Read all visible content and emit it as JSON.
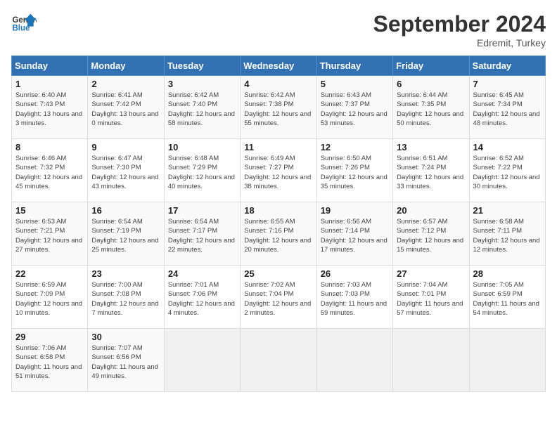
{
  "header": {
    "logo_line1": "General",
    "logo_line2": "Blue",
    "month": "September 2024",
    "location": "Edremit, Turkey"
  },
  "days_of_week": [
    "Sunday",
    "Monday",
    "Tuesday",
    "Wednesday",
    "Thursday",
    "Friday",
    "Saturday"
  ],
  "weeks": [
    [
      {
        "day": "1",
        "sunrise": "6:40 AM",
        "sunset": "7:43 PM",
        "daylight": "13 hours and 3 minutes."
      },
      {
        "day": "2",
        "sunrise": "6:41 AM",
        "sunset": "7:42 PM",
        "daylight": "13 hours and 0 minutes."
      },
      {
        "day": "3",
        "sunrise": "6:42 AM",
        "sunset": "7:40 PM",
        "daylight": "12 hours and 58 minutes."
      },
      {
        "day": "4",
        "sunrise": "6:42 AM",
        "sunset": "7:38 PM",
        "daylight": "12 hours and 55 minutes."
      },
      {
        "day": "5",
        "sunrise": "6:43 AM",
        "sunset": "7:37 PM",
        "daylight": "12 hours and 53 minutes."
      },
      {
        "day": "6",
        "sunrise": "6:44 AM",
        "sunset": "7:35 PM",
        "daylight": "12 hours and 50 minutes."
      },
      {
        "day": "7",
        "sunrise": "6:45 AM",
        "sunset": "7:34 PM",
        "daylight": "12 hours and 48 minutes."
      }
    ],
    [
      {
        "day": "8",
        "sunrise": "6:46 AM",
        "sunset": "7:32 PM",
        "daylight": "12 hours and 45 minutes."
      },
      {
        "day": "9",
        "sunrise": "6:47 AM",
        "sunset": "7:30 PM",
        "daylight": "12 hours and 43 minutes."
      },
      {
        "day": "10",
        "sunrise": "6:48 AM",
        "sunset": "7:29 PM",
        "daylight": "12 hours and 40 minutes."
      },
      {
        "day": "11",
        "sunrise": "6:49 AM",
        "sunset": "7:27 PM",
        "daylight": "12 hours and 38 minutes."
      },
      {
        "day": "12",
        "sunrise": "6:50 AM",
        "sunset": "7:26 PM",
        "daylight": "12 hours and 35 minutes."
      },
      {
        "day": "13",
        "sunrise": "6:51 AM",
        "sunset": "7:24 PM",
        "daylight": "12 hours and 33 minutes."
      },
      {
        "day": "14",
        "sunrise": "6:52 AM",
        "sunset": "7:22 PM",
        "daylight": "12 hours and 30 minutes."
      }
    ],
    [
      {
        "day": "15",
        "sunrise": "6:53 AM",
        "sunset": "7:21 PM",
        "daylight": "12 hours and 27 minutes."
      },
      {
        "day": "16",
        "sunrise": "6:54 AM",
        "sunset": "7:19 PM",
        "daylight": "12 hours and 25 minutes."
      },
      {
        "day": "17",
        "sunrise": "6:54 AM",
        "sunset": "7:17 PM",
        "daylight": "12 hours and 22 minutes."
      },
      {
        "day": "18",
        "sunrise": "6:55 AM",
        "sunset": "7:16 PM",
        "daylight": "12 hours and 20 minutes."
      },
      {
        "day": "19",
        "sunrise": "6:56 AM",
        "sunset": "7:14 PM",
        "daylight": "12 hours and 17 minutes."
      },
      {
        "day": "20",
        "sunrise": "6:57 AM",
        "sunset": "7:12 PM",
        "daylight": "12 hours and 15 minutes."
      },
      {
        "day": "21",
        "sunrise": "6:58 AM",
        "sunset": "7:11 PM",
        "daylight": "12 hours and 12 minutes."
      }
    ],
    [
      {
        "day": "22",
        "sunrise": "6:59 AM",
        "sunset": "7:09 PM",
        "daylight": "12 hours and 10 minutes."
      },
      {
        "day": "23",
        "sunrise": "7:00 AM",
        "sunset": "7:08 PM",
        "daylight": "12 hours and 7 minutes."
      },
      {
        "day": "24",
        "sunrise": "7:01 AM",
        "sunset": "7:06 PM",
        "daylight": "12 hours and 4 minutes."
      },
      {
        "day": "25",
        "sunrise": "7:02 AM",
        "sunset": "7:04 PM",
        "daylight": "12 hours and 2 minutes."
      },
      {
        "day": "26",
        "sunrise": "7:03 AM",
        "sunset": "7:03 PM",
        "daylight": "11 hours and 59 minutes."
      },
      {
        "day": "27",
        "sunrise": "7:04 AM",
        "sunset": "7:01 PM",
        "daylight": "11 hours and 57 minutes."
      },
      {
        "day": "28",
        "sunrise": "7:05 AM",
        "sunset": "6:59 PM",
        "daylight": "11 hours and 54 minutes."
      }
    ],
    [
      {
        "day": "29",
        "sunrise": "7:06 AM",
        "sunset": "6:58 PM",
        "daylight": "11 hours and 51 minutes."
      },
      {
        "day": "30",
        "sunrise": "7:07 AM",
        "sunset": "6:56 PM",
        "daylight": "11 hours and 49 minutes."
      },
      {
        "day": "",
        "sunrise": "",
        "sunset": "",
        "daylight": ""
      },
      {
        "day": "",
        "sunrise": "",
        "sunset": "",
        "daylight": ""
      },
      {
        "day": "",
        "sunrise": "",
        "sunset": "",
        "daylight": ""
      },
      {
        "day": "",
        "sunrise": "",
        "sunset": "",
        "daylight": ""
      },
      {
        "day": "",
        "sunrise": "",
        "sunset": "",
        "daylight": ""
      }
    ]
  ]
}
